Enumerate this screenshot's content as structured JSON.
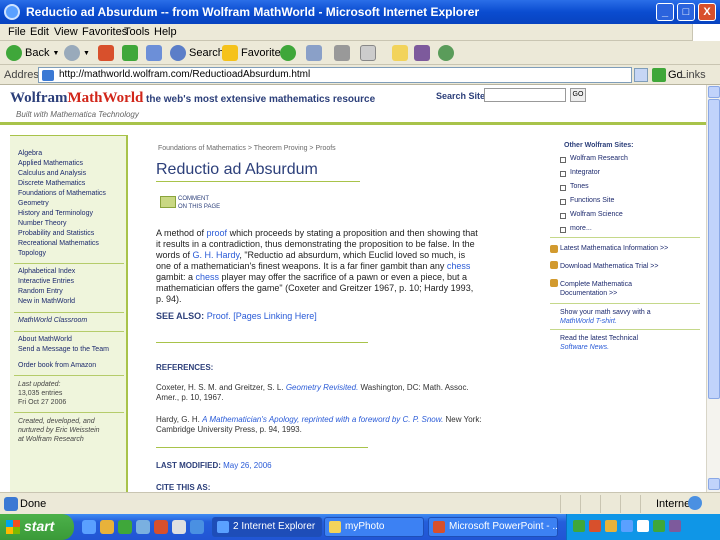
{
  "window": {
    "title": "Reductio ad Absurdum -- from Wolfram MathWorld - Microsoft Internet Explorer",
    "controls": [
      "_",
      "□",
      "X"
    ]
  },
  "menu": [
    "File",
    "Edit",
    "View",
    "Favorites",
    "Tools",
    "Help"
  ],
  "toolbar": {
    "back": "Back",
    "search": "Search",
    "favorites": "Favorites"
  },
  "address": {
    "label": "Address",
    "url": "http://mathworld.wolfram.com/ReductioadAbsurdum.html",
    "go": "Go",
    "links": "Links"
  },
  "site": {
    "logo_a": "Wolfram",
    "logo_b": "MathWorld",
    "tagline": "the web's most extensive mathematics resource",
    "subtag": "Built with Mathematica Technology",
    "search_label": "Search Site",
    "search_button": "GO"
  },
  "leftnav": {
    "topics": [
      "Algebra",
      "Applied Mathematics",
      "Calculus and Analysis",
      "Discrete Mathematics",
      "Foundations of Mathematics",
      "Geometry",
      "History and Terminology",
      "Number Theory",
      "Probability and Statistics",
      "Recreational Mathematics",
      "Topology"
    ],
    "tools": [
      "Alphabetical Index",
      "Interactive Entries",
      "Random Entry",
      "New in MathWorld"
    ],
    "classroom": "MathWorld Classroom",
    "about": [
      "About MathWorld",
      "Send a Message to the Team",
      "Order book from Amazon"
    ],
    "updated_label": "Last updated:",
    "updated_entries": "13,035 entries",
    "updated_date": "Fri Oct 27 2006",
    "created": [
      "Created, developed, and",
      "nurtured by Eric Weisstein",
      "at Wolfram Research"
    ]
  },
  "main": {
    "breadcrumb": "Foundations of Mathematics > Theorem Proving > Proofs",
    "title": "Reductio ad Absurdum",
    "comment": [
      "COMMENT",
      "ON THIS PAGE"
    ],
    "para_lines": [
      [
        "A method of ",
        "proof",
        " which proceeds by stating a proposition and then showing that"
      ],
      [
        "it results in a contradiction, thus demonstrating the proposition to be false. In the",
        "",
        ""
      ],
      [
        "words of ",
        "G. H. Hardy",
        ", \"Reductio ad absurdum, which Euclid loved so much, is"
      ],
      [
        "one of a mathematician's finest weapons. It is a far finer gambit than any ",
        "chess",
        ""
      ],
      [
        "gambit: a ",
        "chess",
        " player may offer the sacrifice of a pawn or even a piece, but a"
      ],
      [
        "mathematician offers the game\" (Coxeter and Greitzer 1967, p. 10; Hardy 1993,",
        "",
        ""
      ],
      [
        "p. 94).",
        "",
        ""
      ]
    ],
    "see_also_label": "SEE ALSO:",
    "see_also": "Proof. [Pages Linking Here]",
    "references_label": "REFERENCES:",
    "ref1a": "Coxeter, H. S. M. and Greitzer, S. L. ",
    "ref1b": "Geometry Revisited.",
    "ref1c": " Washington, DC: Math. Assoc.",
    "ref1d": "Amer., p. 10, 1967.",
    "ref2a": "Hardy, G. H. ",
    "ref2b": "A Mathematician's Apology, reprinted with a foreword by C. P. Snow.",
    "ref2c": " New York:",
    "ref2d": "Cambridge University Press, p. 94, 1993.",
    "modified_label": "LAST MODIFIED:",
    "modified": "May 26, 2006",
    "cite_label": "CITE THIS AS:"
  },
  "rightcol": {
    "heading": "Other Wolfram Sites:",
    "sites": [
      "Wolfram Research",
      "Integrator",
      "Tones",
      "Functions Site",
      "Wolfram Science",
      "more..."
    ],
    "news": [
      "Latest Mathematica Information >>",
      "Download Mathematica Trial >>",
      "Complete Mathematica",
      "Documentation >>"
    ],
    "promo1": [
      "Show your math savvy with a",
      "MathWorld T-shirt."
    ],
    "promo2": [
      "Read the latest Technical",
      "Software News."
    ]
  },
  "status": {
    "done": "Done",
    "zone": "Internet"
  },
  "taskbar": {
    "start": "start",
    "tasks": [
      "2 Internet Explorer",
      "myPhoto",
      "Microsoft PowerPoint - ..."
    ]
  }
}
